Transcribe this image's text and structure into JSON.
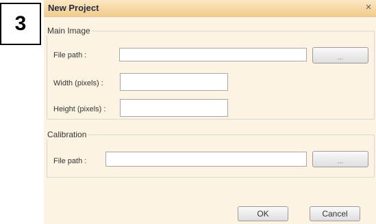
{
  "step_badge": "3",
  "dialog": {
    "title": "New Project",
    "close_glyph": "×"
  },
  "main_image": {
    "legend": "Main Image",
    "file_path_label": "File path :",
    "file_path_value": "",
    "browse_label": "...",
    "width_label": "Width (pixels) :",
    "width_value": "",
    "height_label": "Height (pixels) :",
    "height_value": ""
  },
  "calibration": {
    "legend": "Calibration",
    "file_path_label": "File path :",
    "file_path_value": "",
    "browse_label": "..."
  },
  "buttons": {
    "ok": "OK",
    "cancel": "Cancel"
  },
  "colors": {
    "titlebar": "#f6d6a0",
    "dialog_background": "#fdf3e3",
    "fieldset_border": "#d7d7d7"
  }
}
